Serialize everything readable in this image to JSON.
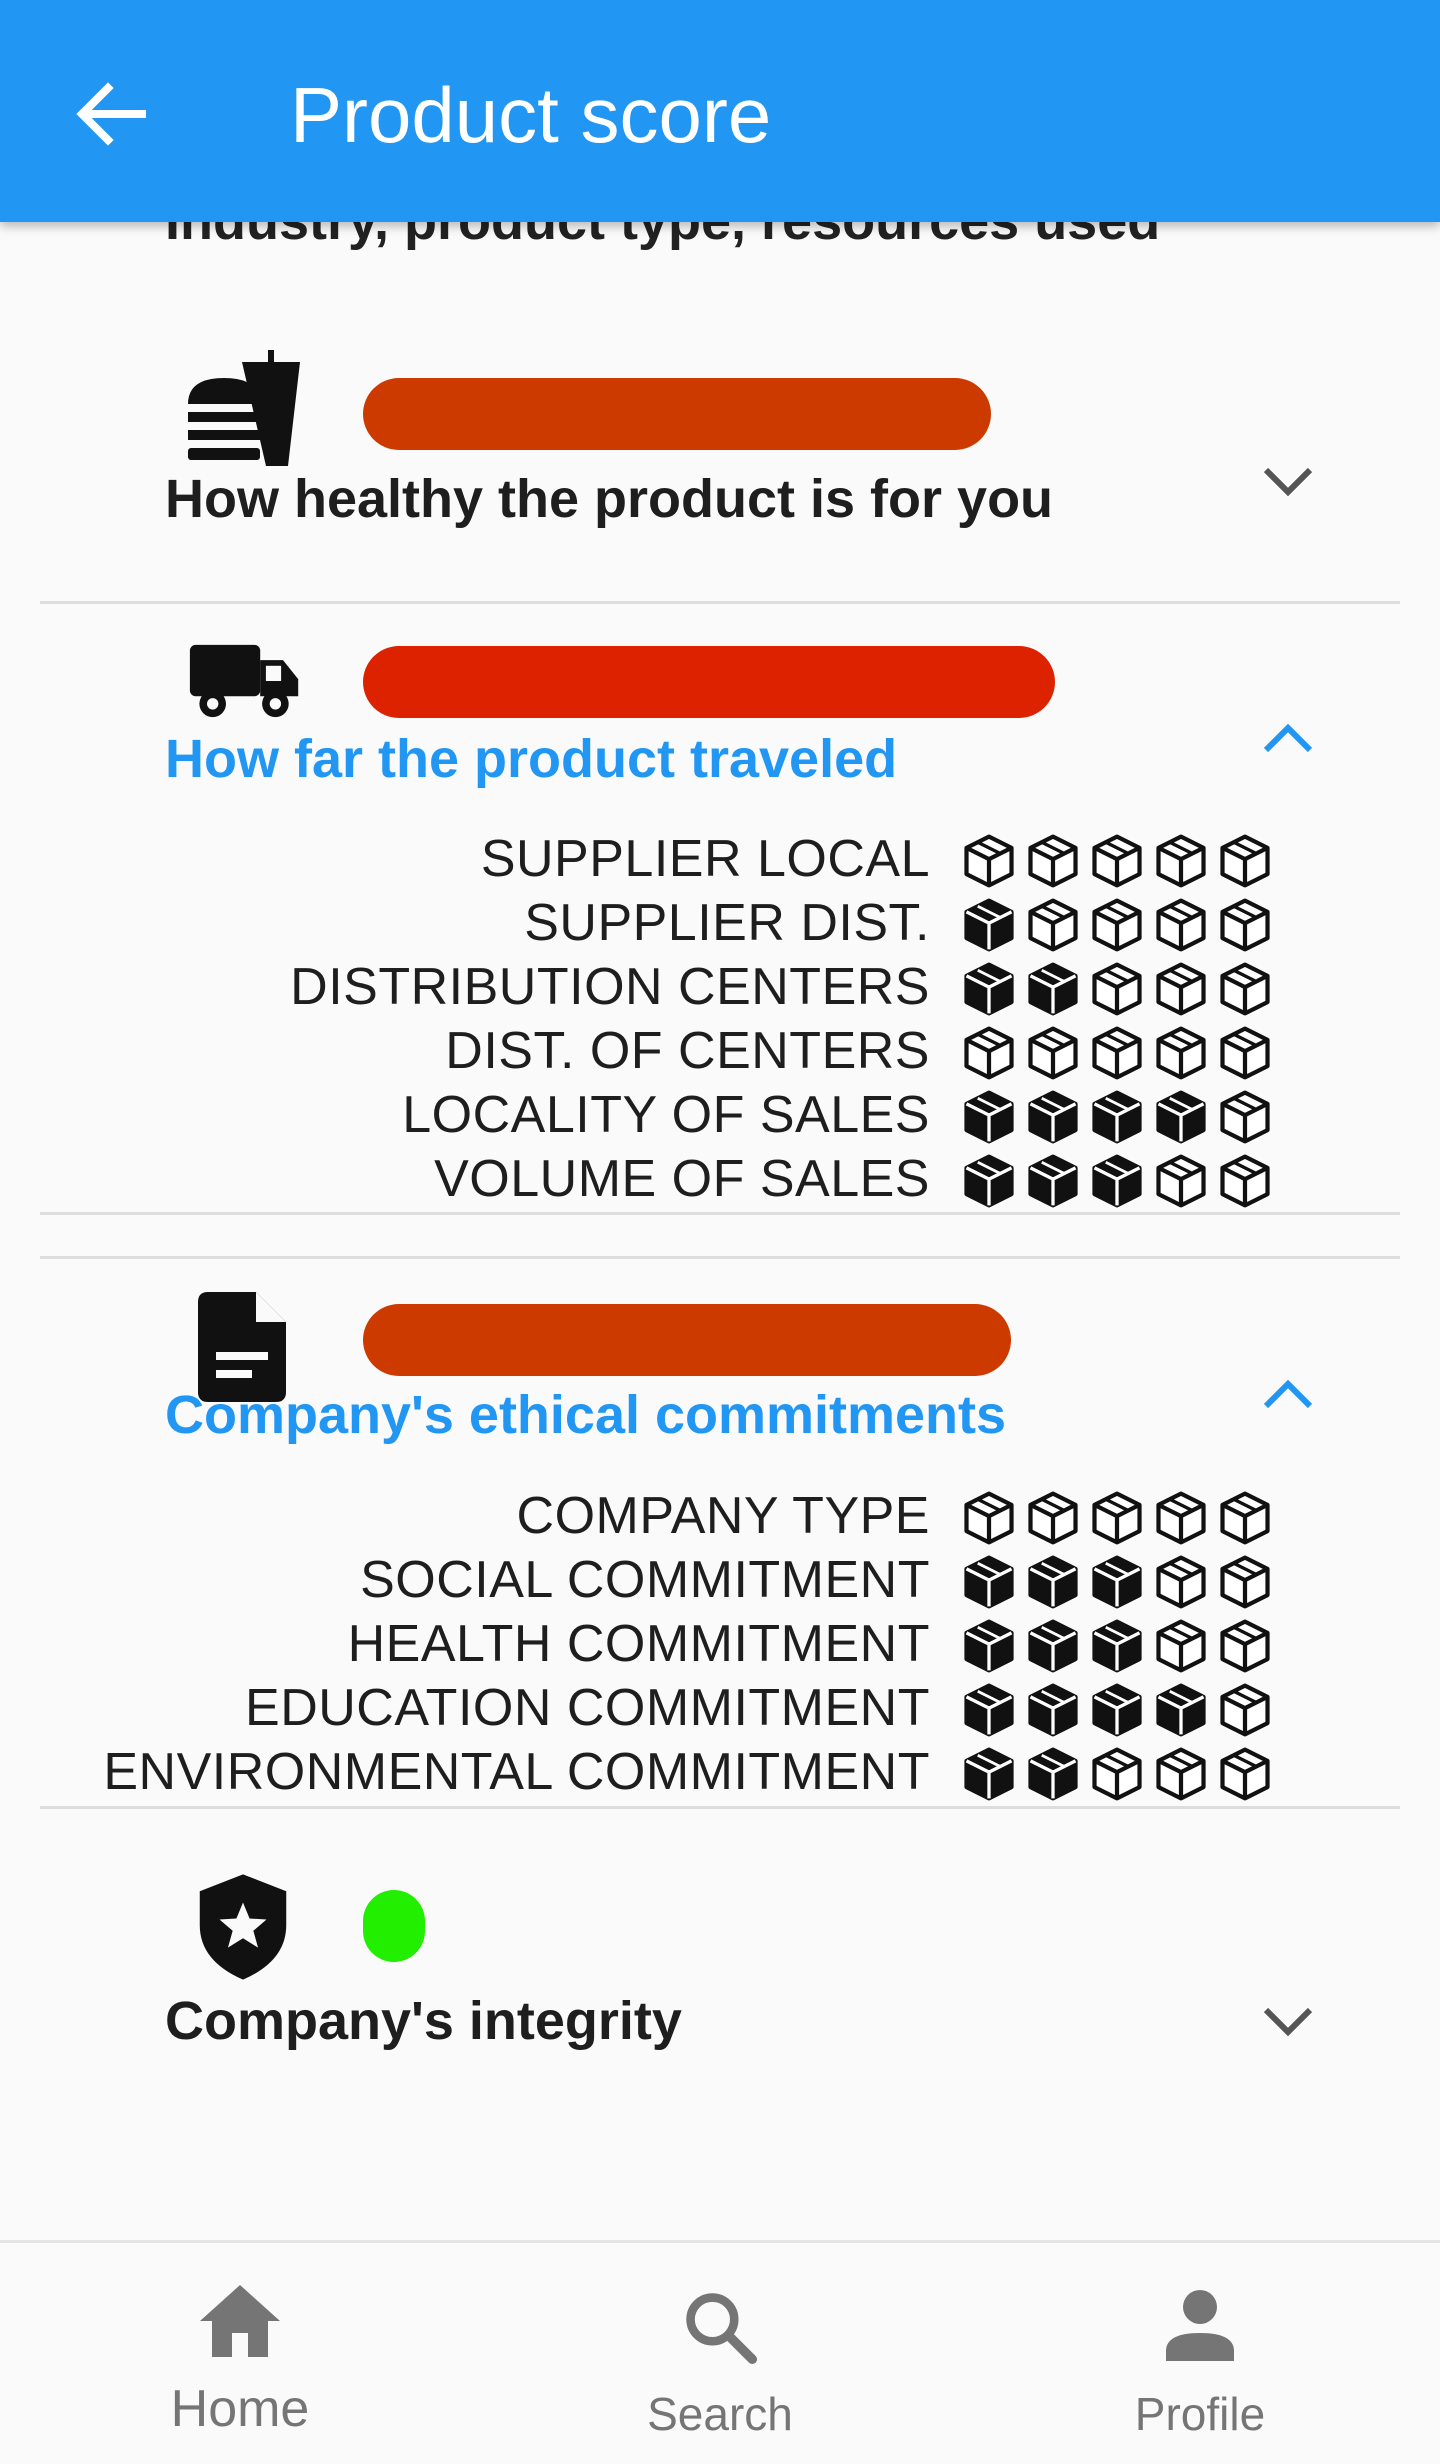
{
  "appbar": {
    "title": "Product score",
    "back_icon": "arrow-back-icon",
    "color": "#2196f3"
  },
  "partial_text": "Industry, product type, resources used",
  "sections": [
    {
      "id": "health",
      "icon": "fastfood-icon",
      "label": "How healthy the product is for you",
      "expanded": false,
      "bar_color": "#cc3a00"
    },
    {
      "id": "travel",
      "icon": "truck-icon",
      "label": "How far the product traveled",
      "expanded": true,
      "bar_color": "#dd2200",
      "rows": [
        {
          "label": "SUPPLIER LOCAL",
          "filled": 0,
          "max": 5
        },
        {
          "label": "SUPPLIER DIST.",
          "filled": 1,
          "max": 5
        },
        {
          "label": "DISTRIBUTION CENTERS",
          "filled": 2,
          "max": 5
        },
        {
          "label": "DIST. OF CENTERS",
          "filled": 0,
          "max": 5
        },
        {
          "label": "LOCALITY OF SALES",
          "filled": 4,
          "max": 5
        },
        {
          "label": "VOLUME OF SALES",
          "filled": 3,
          "max": 5
        }
      ]
    },
    {
      "id": "ethics",
      "icon": "document-icon",
      "label": "Company's ethical commitments",
      "expanded": true,
      "bar_color": "#cc3a00",
      "rows": [
        {
          "label": "COMPANY TYPE",
          "filled": 0,
          "max": 5
        },
        {
          "label": "SOCIAL COMMITMENT",
          "filled": 3,
          "max": 5
        },
        {
          "label": "HEALTH COMMITMENT",
          "filled": 3,
          "max": 5
        },
        {
          "label": "EDUCATION COMMITMENT",
          "filled": 4,
          "max": 5
        },
        {
          "label": "ENVIRONMENTAL COMMITMENT",
          "filled": 2,
          "max": 5
        }
      ]
    },
    {
      "id": "integrity",
      "icon": "shield-star-icon",
      "label": "Company's integrity",
      "expanded": false,
      "bar_color": "#22ee00"
    }
  ],
  "bottom_nav": [
    {
      "label": "Home",
      "icon": "home-icon",
      "active": true
    },
    {
      "label": "Search",
      "icon": "search-icon",
      "active": false
    },
    {
      "label": "Profile",
      "icon": "person-icon",
      "active": false
    }
  ],
  "colors": {
    "accent": "#2196f3",
    "text": "#1e1e1e",
    "nav_inactive": "#757575"
  }
}
